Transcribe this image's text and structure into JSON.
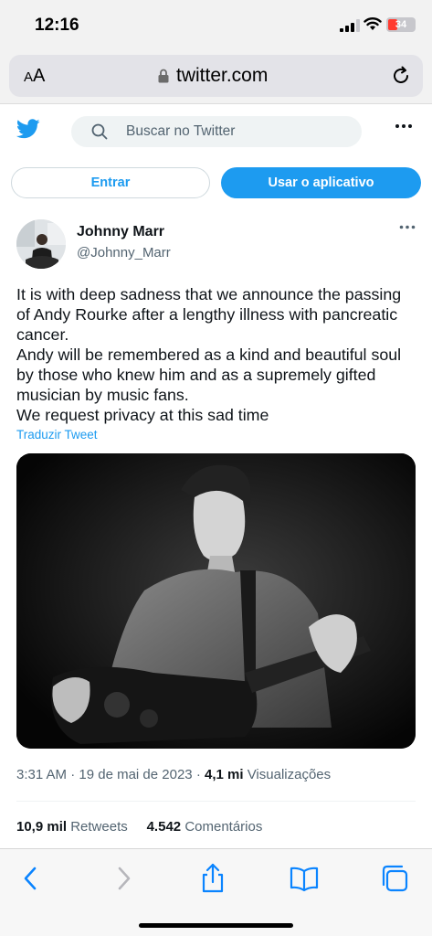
{
  "status": {
    "time": "12:16",
    "battery": "34"
  },
  "browser": {
    "aa_small": "A",
    "aa_big": "A",
    "url": "twitter.com"
  },
  "header": {
    "search_placeholder": "Buscar no Twitter"
  },
  "buttons": {
    "login": "Entrar",
    "app": "Usar o aplicativo"
  },
  "tweet": {
    "author_name": "Johnny Marr",
    "author_handle": "@Johnny_Marr",
    "text_lines": [
      "It is with deep sadness that we announce the passing of Andy Rourke after a lengthy illness with pancreatic cancer.",
      "Andy will be remembered as a kind and beautiful soul by those who knew him and as a supremely gifted musician by music fans.",
      "We request privacy at this sad time"
    ],
    "translate_label": "Traduzir Tweet",
    "time": "3:31 AM",
    "date": "19 de mai de 2023",
    "views_count": "4,1 mi",
    "views_label": "Visualizações",
    "retweets_count": "10,9 mil",
    "retweets_label": "Retweets",
    "comments_count": "4.542",
    "comments_label": "Comentários"
  },
  "colors": {
    "accent": "#1d9bf0",
    "text": "#0f1419",
    "secondary": "#536471",
    "safari_blue": "#0a84ff"
  },
  "icons": {
    "toolbar": [
      "back-icon",
      "forward-icon",
      "share-icon",
      "bookmarks-icon",
      "tabs-icon"
    ]
  }
}
